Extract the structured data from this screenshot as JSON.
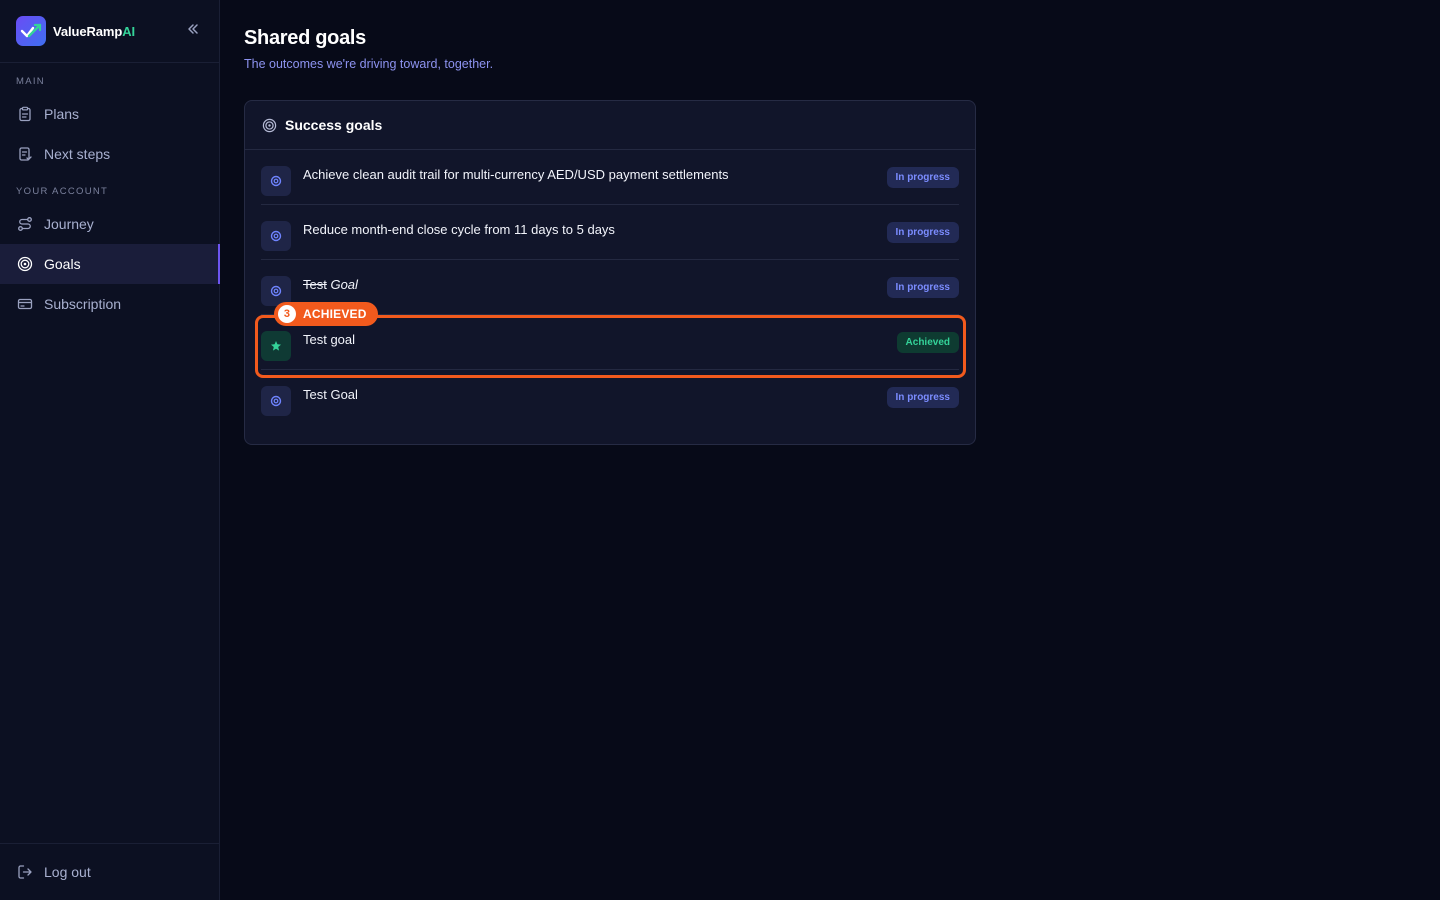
{
  "brand": {
    "name": "ValueRamp",
    "name_suffix": "AI",
    "suffix_color": "#34d399"
  },
  "sidebar": {
    "section_main": "MAIN",
    "section_account": "YOUR ACCOUNT",
    "items": [
      {
        "label": "Plans",
        "icon": "clipboard-icon"
      },
      {
        "label": "Next steps",
        "icon": "checklist-icon"
      },
      {
        "label": "Journey",
        "icon": "route-icon"
      },
      {
        "label": "Goals",
        "icon": "target-icon",
        "active": true
      },
      {
        "label": "Subscription",
        "icon": "credit-card-icon"
      }
    ],
    "logout_label": "Log out"
  },
  "page": {
    "title": "Shared goals",
    "subtitle": "The outcomes we're driving toward, together."
  },
  "card": {
    "title": "Success goals",
    "goals": [
      {
        "text": "Achieve clean audit trail for multi-currency AED/USD payment settlements",
        "status": "In progress"
      },
      {
        "text": "Reduce month-end close cycle from 11 days to 5 days",
        "status": "In progress"
      },
      {
        "text_strike": "Test",
        "text_italic": "Goal",
        "status": "In progress"
      },
      {
        "text": "Test goal",
        "status": "Achieved"
      },
      {
        "text": "Test Goal",
        "status": "In progress"
      }
    ]
  },
  "highlight": {
    "number": "3",
    "label": "ACHIEVED",
    "color": "#f25a1d"
  },
  "colors": {
    "accent": "#6d55f0",
    "in_progress": "#7b8cff",
    "achieved": "#34d399"
  }
}
